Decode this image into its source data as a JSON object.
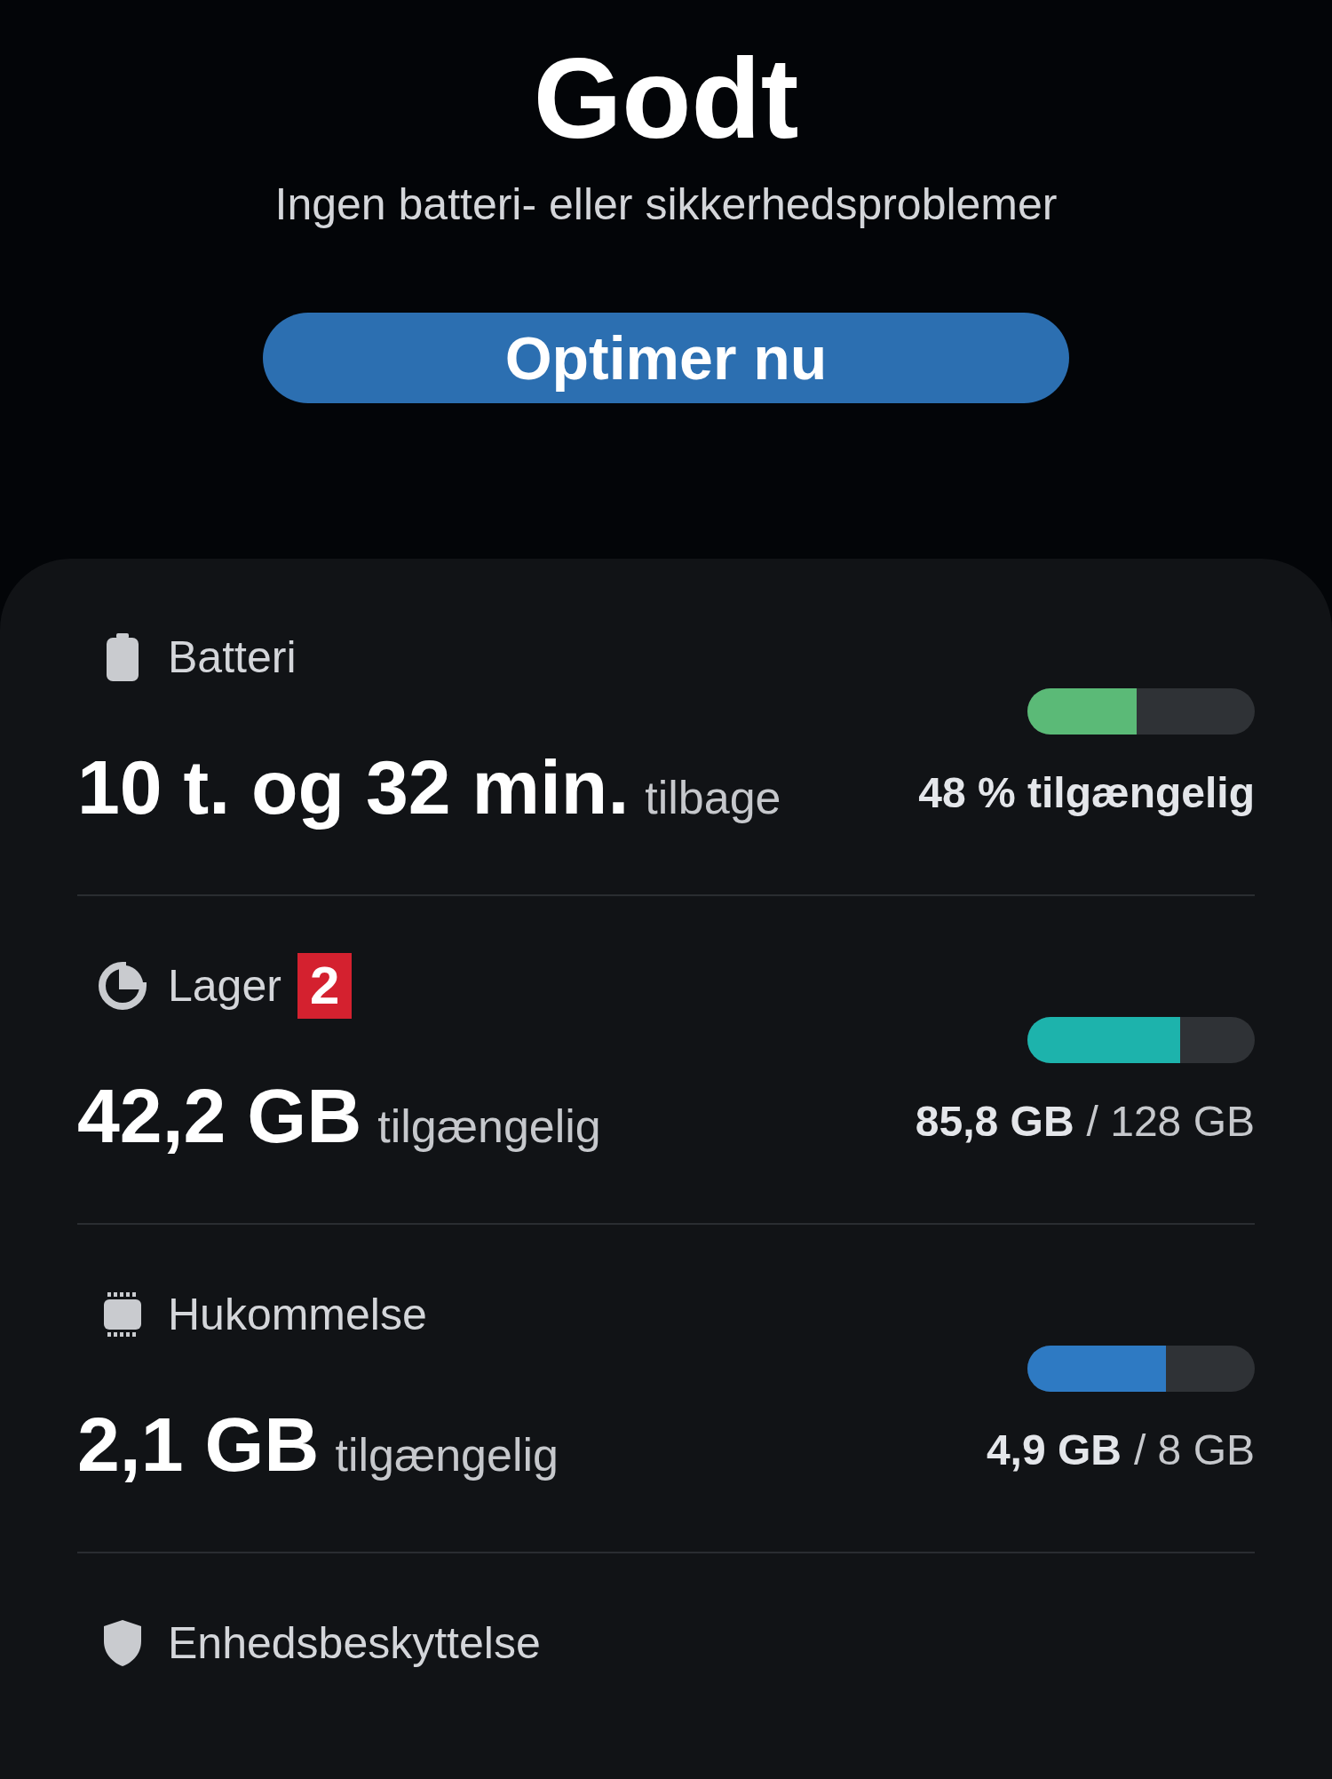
{
  "status": {
    "title": "Godt",
    "subtitle": "Ingen batteri- eller sikkerhedsproblemer"
  },
  "action_button": {
    "label": "Optimer nu"
  },
  "items": [
    {
      "kind": "battery",
      "label": "Batteri",
      "value": "10 t. og 32 min.",
      "value_suffix": "tilbage",
      "level": 0.48,
      "color": "#5bba77",
      "caption": "48 % tilgængelig"
    },
    {
      "kind": "storage",
      "label": "Lager",
      "marker": "2",
      "value": "42,2 GB",
      "value_suffix": "tilgængelig",
      "level": 0.67,
      "color": "#1db3ac",
      "caption_used": "85,8 GB",
      "caption_total": "/ 128 GB"
    },
    {
      "kind": "memory",
      "label": "Hukommelse",
      "value": "2,1 GB",
      "value_suffix": "tilgængelig",
      "level": 0.61,
      "color": "#2e7ac3",
      "caption_used": "4,9 GB",
      "caption_total": "/ 8 GB"
    },
    {
      "kind": "protection",
      "label": "Enhedsbeskyttelse"
    }
  ]
}
